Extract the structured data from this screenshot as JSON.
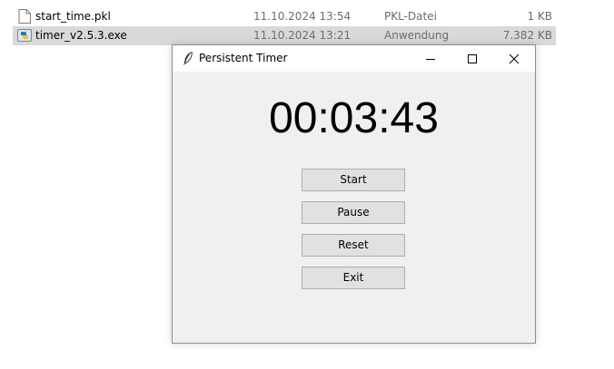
{
  "explorer": {
    "files": [
      {
        "name": "start_time.pkl",
        "date": "11.10.2024 13:54",
        "type": "PKL-Datei",
        "size": "1 KB",
        "icon": "document-icon",
        "selected": false
      },
      {
        "name": "timer_v2.5.3.exe",
        "date": "11.10.2024 13:21",
        "type": "Anwendung",
        "size": "7.382 KB",
        "icon": "python-exe-icon",
        "selected": true
      }
    ]
  },
  "window": {
    "title": "Persistent Timer",
    "icon": "feather-icon",
    "timer": "00:03:43",
    "buttons": {
      "start": "Start",
      "pause": "Pause",
      "reset": "Reset",
      "exit": "Exit"
    }
  }
}
